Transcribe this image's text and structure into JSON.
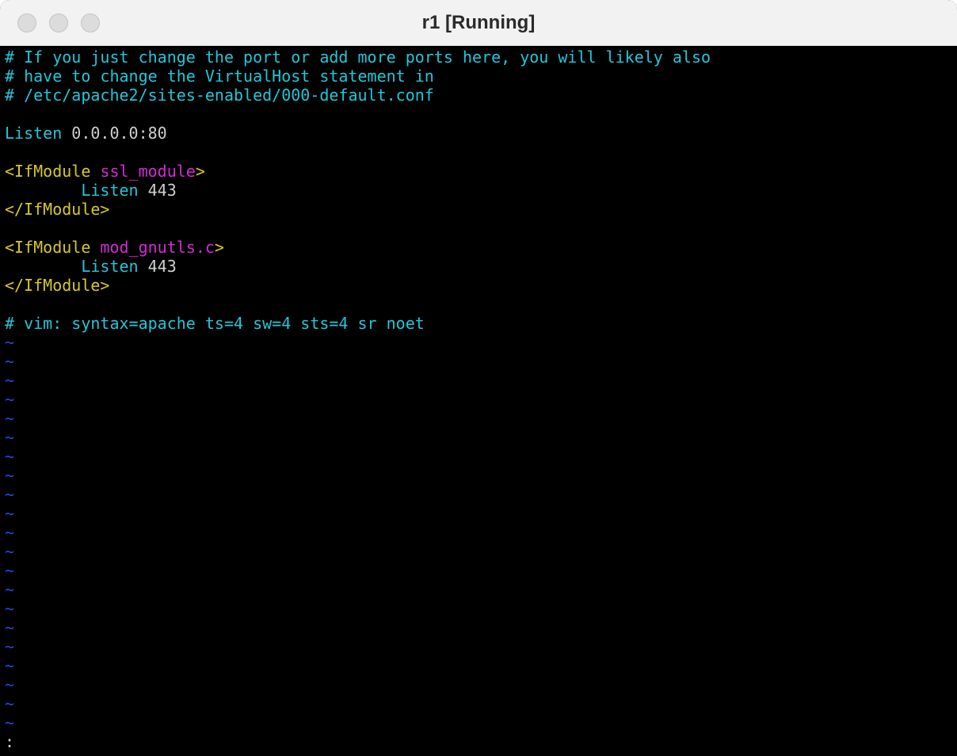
{
  "window": {
    "title": "r1 [Running]"
  },
  "editor": {
    "comment1": "# If you just change the port or add more ports here, you will likely also",
    "comment2": "# have to change the VirtualHost statement in",
    "comment3": "# /etc/apache2/sites-enabled/000-default.conf",
    "listen_keyword": "Listen",
    "listen_value": " 0.0.0.0:80",
    "block1": {
      "open_tag": "<IfModule",
      "module": "ssl_module",
      "close_bracket": ">",
      "indent": "        ",
      "directive": "Listen",
      "value": " 443",
      "end_tag": "</IfModule>"
    },
    "block2": {
      "open_tag": "<IfModule",
      "module": "mod_gnutls.c",
      "close_bracket": ">",
      "indent": "        ",
      "directive": "Listen",
      "value": " 443",
      "end_tag": "</IfModule>"
    },
    "modeline": "# vim: syntax=apache ts=4 sw=4 sts=4 sr noet",
    "tilde": "~",
    "command_line": ":"
  },
  "colors": {
    "comment": "#22c6d9",
    "tag": "#d6c92a",
    "argument": "#d42ad6",
    "tilde": "#2b45e0",
    "text": "#cfcfcf",
    "background": "#000000"
  }
}
